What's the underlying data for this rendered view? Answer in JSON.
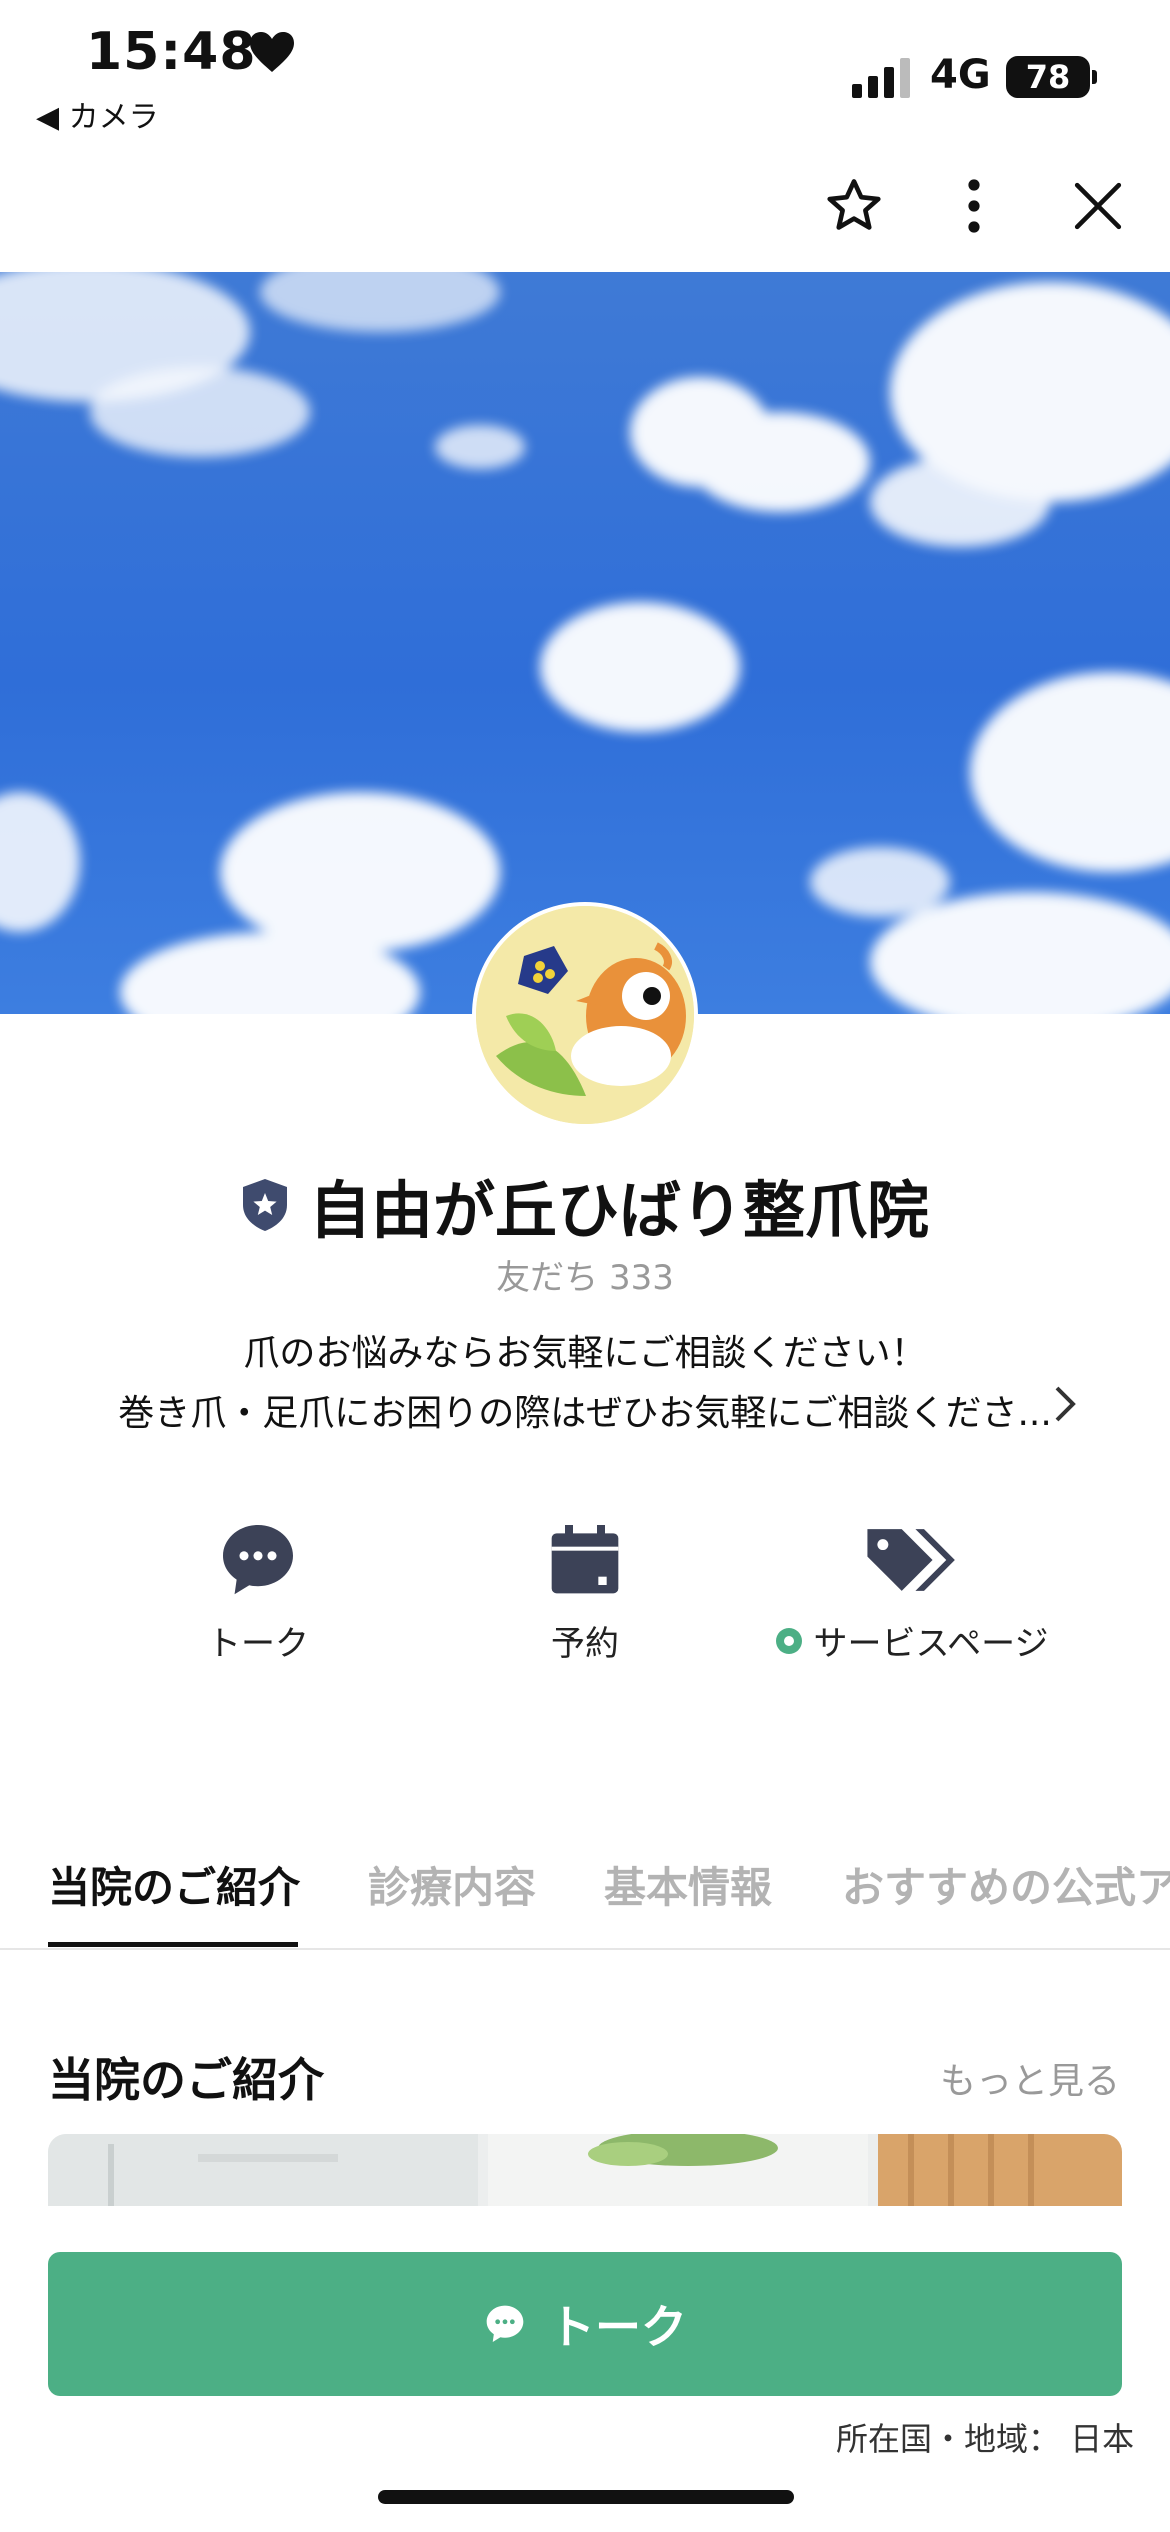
{
  "status_bar": {
    "time": "15:48",
    "back_label": "◀ カメラ",
    "network": "4G",
    "battery": "78"
  },
  "profile": {
    "name": "自由が丘ひばり整爪院",
    "friends": "友だち 333",
    "description_line1": "爪のお悩みならお気軽にご相談ください！",
    "description_line2": "巻き爪・足爪にお困りの際はぜひお気軽にご相談くださ..."
  },
  "actions": [
    {
      "label": "トーク",
      "icon": "chat-bubble-icon"
    },
    {
      "label": "予約",
      "icon": "calendar-icon"
    },
    {
      "label": "サービスページ",
      "icon": "tag-icon"
    }
  ],
  "tabs": [
    "当院のご紹介",
    "診療内容",
    "基本情報",
    "おすすめの公式ア"
  ],
  "section": {
    "title": "当院のご紹介",
    "more": "もっと見る"
  },
  "talk_button": {
    "label": "トーク"
  },
  "region": "所在国・地域： 日本",
  "colors": {
    "accent_green": "#4caf85",
    "sky_blue": "#2f6fd6"
  }
}
